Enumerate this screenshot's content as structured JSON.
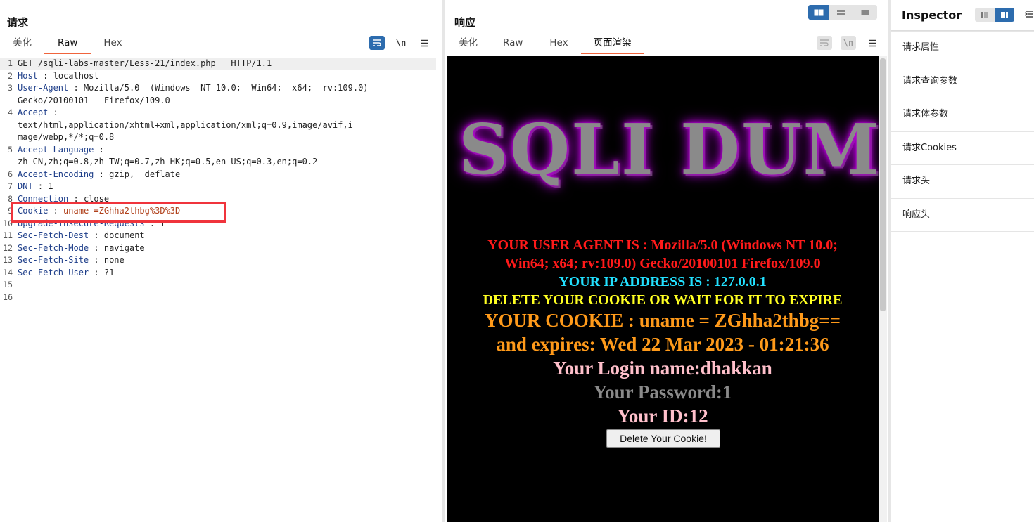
{
  "request": {
    "title": "请求",
    "tabs": [
      {
        "label": "美化"
      },
      {
        "label": "Raw"
      },
      {
        "label": "Hex"
      }
    ],
    "toolbar": {
      "wrap_icon": "wrap-lines-icon",
      "newline_label": "\\n",
      "menu_icon": "hamburger-menu-icon"
    },
    "lines": [
      {
        "n": "1",
        "key": "",
        "sep": "",
        "val": "GET /sqli-labs-master/Less-21/index.php   HTTP/1.1"
      },
      {
        "n": "2",
        "key": "Host",
        "sep": " : ",
        "val": "localhost"
      },
      {
        "n": "3",
        "key": "User-Agent",
        "sep": " : ",
        "val": "Mozilla/5.0  (Windows  NT 10.0;  Win64;  x64;  rv:109.0)"
      },
      {
        "n": "",
        "key": "",
        "sep": "",
        "val": "Gecko/20100101   Firefox/109.0"
      },
      {
        "n": "4",
        "key": "Accept",
        "sep": " :",
        "val": ""
      },
      {
        "n": "",
        "key": "",
        "sep": "",
        "val": "text/html,application/xhtml+xml,application/xml;q=0.9,image/avif,i"
      },
      {
        "n": "",
        "key": "",
        "sep": "",
        "val": "mage/webp,*/*;q=0.8"
      },
      {
        "n": "5",
        "key": "Accept-Language",
        "sep": " :",
        "val": ""
      },
      {
        "n": "",
        "key": "",
        "sep": "",
        "val": "zh-CN,zh;q=0.8,zh-TW;q=0.7,zh-HK;q=0.5,en-US;q=0.3,en;q=0.2"
      },
      {
        "n": "6",
        "key": "Accept-Encoding",
        "sep": " : ",
        "val": "gzip,  deflate"
      },
      {
        "n": "7",
        "key": "DNT",
        "sep": " : ",
        "val": "1"
      },
      {
        "n": "8",
        "key": "Connection",
        "sep": " : ",
        "val": "close"
      },
      {
        "n": "9",
        "key": "Cookie",
        "sep": " : ",
        "val": "uname =ZGhha2thbg%3D%3D"
      },
      {
        "n": "10",
        "key": "Upgrade-Insecure-Requests",
        "sep": " : ",
        "val": "1"
      },
      {
        "n": "11",
        "key": "Sec-Fetch-Dest",
        "sep": " : ",
        "val": "document"
      },
      {
        "n": "12",
        "key": "Sec-Fetch-Mode",
        "sep": " : ",
        "val": "navigate"
      },
      {
        "n": "13",
        "key": "Sec-Fetch-Site",
        "sep": " : ",
        "val": "none"
      },
      {
        "n": "14",
        "key": "Sec-Fetch-User",
        "sep": " : ",
        "val": "?1"
      },
      {
        "n": "15",
        "key": "",
        "sep": "",
        "val": ""
      },
      {
        "n": "16",
        "key": "",
        "sep": "",
        "val": ""
      }
    ]
  },
  "response": {
    "title": "响应",
    "tabs": [
      {
        "label": "美化"
      },
      {
        "label": "Raw"
      },
      {
        "label": "Hex"
      },
      {
        "label": "页面渲染"
      }
    ],
    "toolbar": {
      "newline_label": "\\n"
    },
    "layout_icons": [
      "side-by-side-layout-icon",
      "stacked-layout-icon",
      "single-pane-layout-icon"
    ],
    "render": {
      "logo": "SQLI DUM",
      "ua_line1": "YOUR USER AGENT IS : Mozilla/5.0 (Windows NT 10.0;",
      "ua_line2": "Win64; x64; rv:109.0) Gecko/20100101 Firefox/109.0",
      "ip": "YOUR IP ADDRESS IS : 127.0.0.1",
      "delete_notice": "DELETE YOUR COOKIE OR WAIT FOR IT TO EXPIRE",
      "cookie": "YOUR COOKIE : uname = ZGhha2thbg==",
      "expires": "and expires: Wed 22 Mar 2023 - 01:21:36",
      "login": "Your Login name:dhakkan",
      "password": "Your Password:1",
      "id": "Your ID:12",
      "delete_button": "Delete Your Cookie!"
    }
  },
  "inspector": {
    "title": "Inspector",
    "items": [
      {
        "label": "请求属性"
      },
      {
        "label": "请求查询参数"
      },
      {
        "label": "请求体参数"
      },
      {
        "label": "请求Cookies"
      },
      {
        "label": "请求头"
      },
      {
        "label": "响应头"
      }
    ]
  },
  "colors": {
    "accent_orange": "#f0643c",
    "button_blue": "#2d6cae",
    "highlight_red": "#f0343c",
    "ua_red": "#ff1a1a",
    "ip_cyan": "#22e0ff",
    "notice_yellow": "#ffff22",
    "cookie_orange": "#ff9a1a",
    "login_pink": "#ffc0cb",
    "password_grey": "#8a8a8a"
  }
}
